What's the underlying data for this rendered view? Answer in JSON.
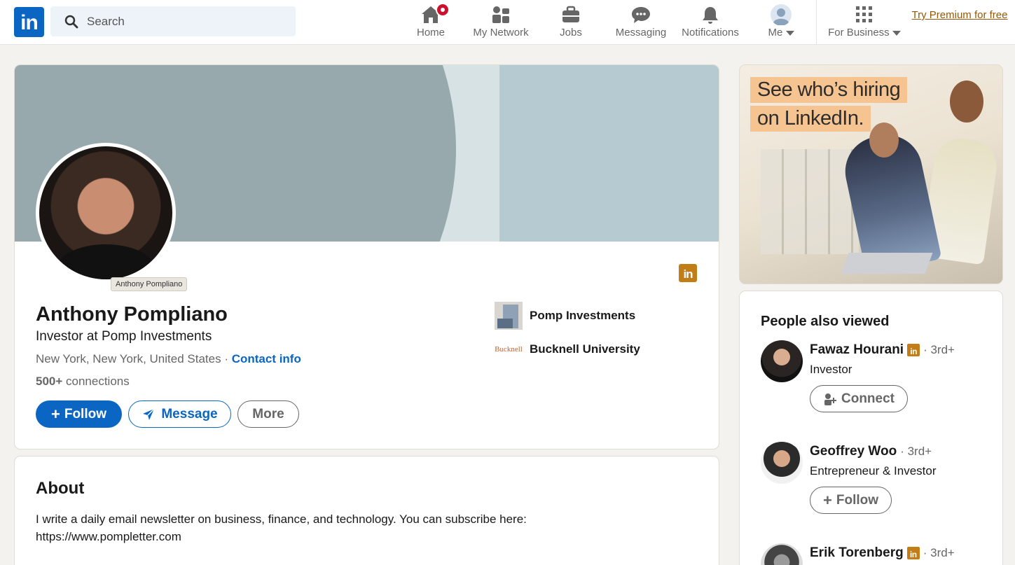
{
  "nav": {
    "logo": "in",
    "search_placeholder": "Search",
    "items": [
      {
        "label": "Home",
        "icon": "home-icon"
      },
      {
        "label": "My Network",
        "icon": "network-icon"
      },
      {
        "label": "Jobs",
        "icon": "briefcase-icon"
      },
      {
        "label": "Messaging",
        "icon": "messaging-icon"
      },
      {
        "label": "Notifications",
        "icon": "bell-icon"
      },
      {
        "label": "Me",
        "icon": "avatar-icon"
      },
      {
        "label": "For Business",
        "icon": "grid-icon"
      }
    ],
    "premium": "Try Premium for free"
  },
  "profile": {
    "photo_tooltip": "Anthony Pompliano",
    "name": "Anthony Pompliano",
    "headline": "Investor at Pomp Investments",
    "location": "New York, New York, United States",
    "location_sep": " · ",
    "contact_info": "Contact info",
    "connections_count": "500+",
    "connections_label": " connections",
    "buttons": {
      "follow": "Follow",
      "message": "Message",
      "more": "More"
    },
    "orgs": [
      {
        "name": "Pomp Investments"
      },
      {
        "name": "Bucknell University",
        "logo_text": "Bucknell"
      }
    ],
    "badge": "in"
  },
  "about": {
    "title": "About",
    "text_line1": "I write a daily email newsletter on business, finance, and technology. You can subscribe here:",
    "text_line2": "https://www.pompletter.com"
  },
  "ad": {
    "line1": "See who’s hiring",
    "line2": "on LinkedIn."
  },
  "people_also_viewed": {
    "title": "People also viewed",
    "people": [
      {
        "name": "Fawaz Hourani",
        "badge": "in",
        "degree": "· 3rd+",
        "title": "Investor",
        "action": "Connect"
      },
      {
        "name": "Geoffrey Woo",
        "badge": "",
        "degree": "· 3rd+",
        "title": "Entrepreneur & Investor",
        "action": "Follow"
      },
      {
        "name": "Erik Torenberg",
        "badge": "in",
        "degree": "· 3rd+",
        "title": "",
        "action": ""
      }
    ]
  },
  "colors": {
    "brand": "#0a66c2",
    "premium": "#915907",
    "notification": "#cb112d"
  }
}
